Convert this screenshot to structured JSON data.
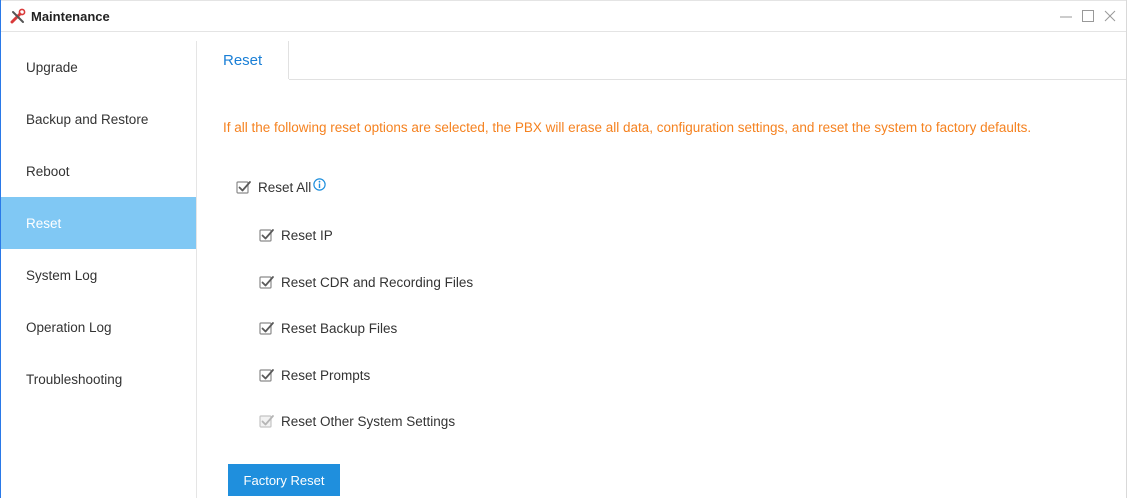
{
  "window": {
    "title": "Maintenance",
    "controls": [
      "minimize",
      "maximize",
      "close"
    ]
  },
  "sidebar": {
    "items": [
      {
        "label": "Upgrade"
      },
      {
        "label": "Backup and Restore"
      },
      {
        "label": "Reboot"
      },
      {
        "label": "Reset",
        "active": true
      },
      {
        "label": "System Log"
      },
      {
        "label": "Operation Log"
      },
      {
        "label": "Troubleshooting"
      }
    ]
  },
  "tabs": [
    {
      "label": "Reset",
      "active": true
    }
  ],
  "reset": {
    "notice": "If all the following reset options are selected, the PBX will erase all data, configuration settings, and reset the system to factory defaults.",
    "reset_all": {
      "label": "Reset All",
      "checked": true
    },
    "options": [
      {
        "label": "Reset IP",
        "checked": true,
        "disabled": false
      },
      {
        "label": "Reset CDR and Recording Files",
        "checked": true,
        "disabled": false
      },
      {
        "label": "Reset Backup Files",
        "checked": true,
        "disabled": false
      },
      {
        "label": "Reset Prompts",
        "checked": true,
        "disabled": false
      },
      {
        "label": "Reset Other System Settings",
        "checked": true,
        "disabled": true
      }
    ],
    "button_label": "Factory Reset"
  },
  "colors": {
    "accent": "#1f8fdd",
    "active_sidebar": "#80c8f4",
    "notice": "#f58220",
    "tab_text": "#1a7fd6"
  },
  "icons": {
    "app": "maintenance-tools-icon",
    "info": "info-icon",
    "checkbox": "checkbox-checked-icon"
  }
}
